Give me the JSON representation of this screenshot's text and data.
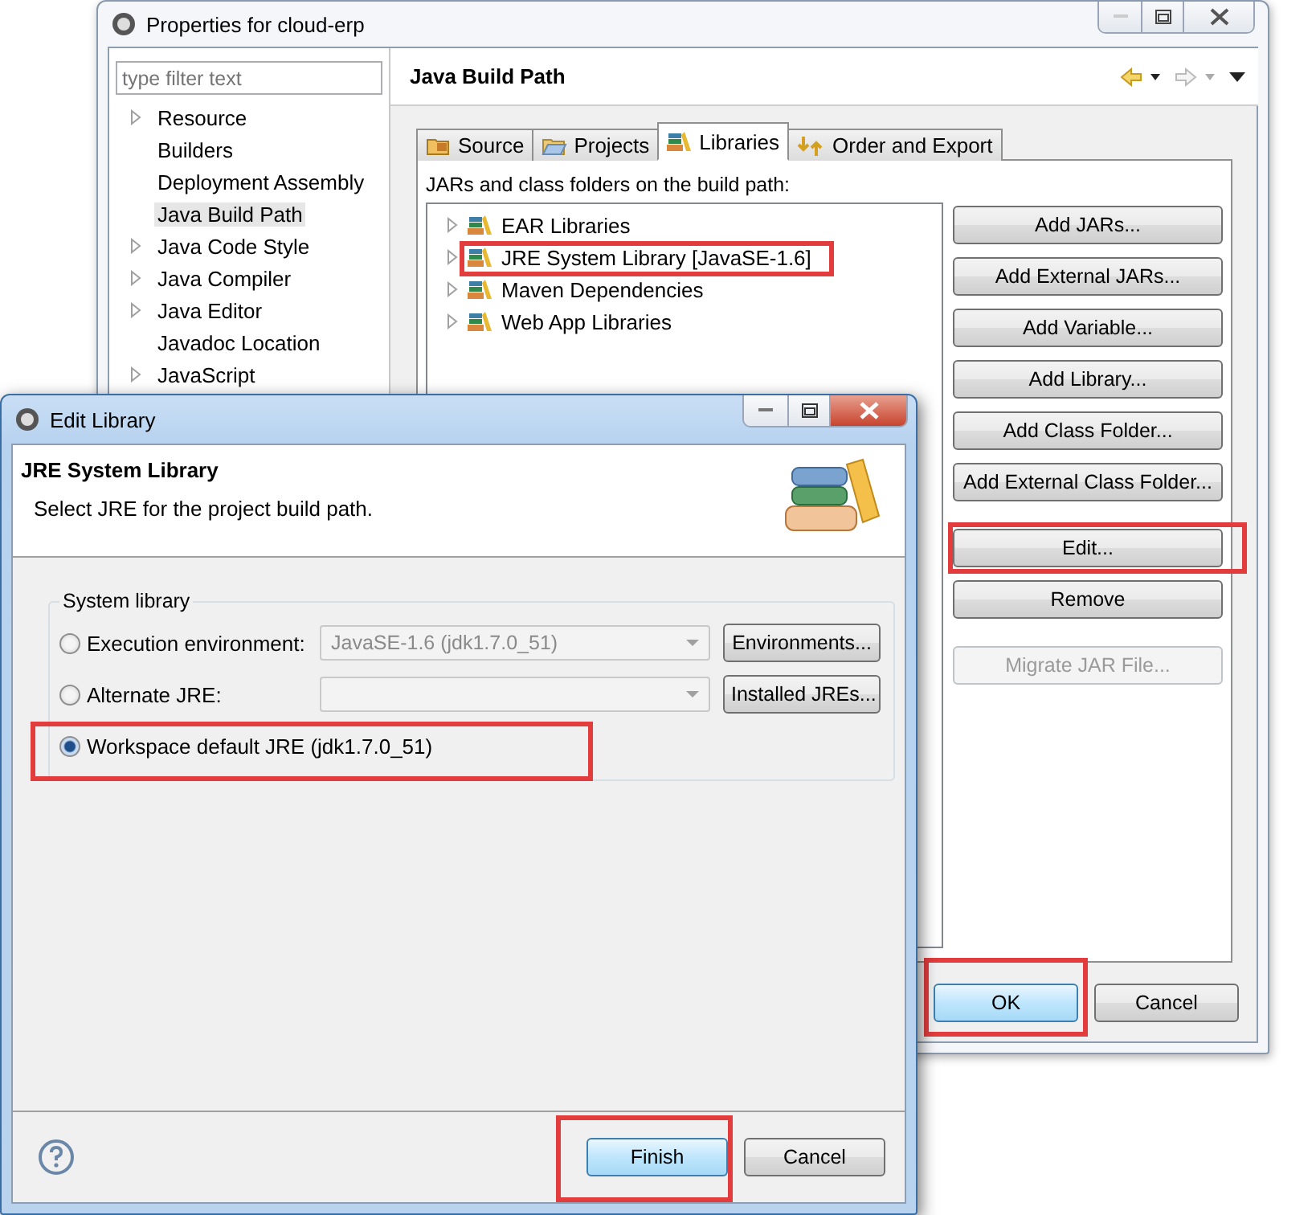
{
  "properties_window": {
    "title": "Properties for cloud-erp",
    "filter": {
      "placeholder": "type filter text"
    },
    "sidebar": {
      "items": [
        {
          "label": "Resource",
          "expandable": true,
          "selected": false
        },
        {
          "label": "Builders",
          "expandable": false,
          "selected": false
        },
        {
          "label": "Deployment Assembly",
          "expandable": false,
          "selected": false
        },
        {
          "label": "Java Build Path",
          "expandable": false,
          "selected": true
        },
        {
          "label": "Java Code Style",
          "expandable": true,
          "selected": false
        },
        {
          "label": "Java Compiler",
          "expandable": true,
          "selected": false
        },
        {
          "label": "Java Editor",
          "expandable": true,
          "selected": false
        },
        {
          "label": "Javadoc Location",
          "expandable": false,
          "selected": false
        },
        {
          "label": "JavaScript",
          "expandable": true,
          "selected": false
        }
      ]
    },
    "page_title": "Java Build Path",
    "tabs": [
      {
        "label": "Source",
        "selected": false
      },
      {
        "label": "Projects",
        "selected": false
      },
      {
        "label": "Libraries",
        "selected": true
      },
      {
        "label": "Order and Export",
        "selected": false
      }
    ],
    "libraries": {
      "caption": "JARs and class folders on the build path:",
      "items": [
        {
          "label": "EAR Libraries",
          "highlighted": false
        },
        {
          "label": "JRE System Library [JavaSE-1.6]",
          "highlighted": true
        },
        {
          "label": "Maven Dependencies",
          "highlighted": false
        },
        {
          "label": "Web App Libraries",
          "highlighted": false
        }
      ]
    },
    "buttons": [
      {
        "label": "Add JARs...",
        "disabled": false,
        "highlighted": false
      },
      {
        "label": "Add External JARs...",
        "disabled": false,
        "highlighted": false
      },
      {
        "label": "Add Variable...",
        "disabled": false,
        "highlighted": false
      },
      {
        "label": "Add Library...",
        "disabled": false,
        "highlighted": false
      },
      {
        "label": "Add Class Folder...",
        "disabled": false,
        "highlighted": false
      },
      {
        "label": "Add External Class Folder...",
        "disabled": false,
        "highlighted": false
      },
      {
        "label": "Edit...",
        "disabled": false,
        "highlighted": true
      },
      {
        "label": "Remove",
        "disabled": false,
        "highlighted": false
      },
      {
        "label": "Migrate JAR File...",
        "disabled": true,
        "highlighted": false
      }
    ],
    "footer_buttons": [
      {
        "label": "OK",
        "default": true,
        "highlighted": true
      },
      {
        "label": "Cancel",
        "default": false,
        "highlighted": false
      }
    ]
  },
  "edit_library_window": {
    "title": "Edit Library",
    "heading": "JRE System Library",
    "description": "Select JRE for the project build path.",
    "group": {
      "label": "System library",
      "options": [
        {
          "kind": "combo",
          "label": "Execution environment:",
          "selected": false,
          "highlighted": false,
          "value": "JavaSE-1.6 (jdk1.7.0_51)",
          "button": "Environments..."
        },
        {
          "kind": "combo",
          "label": "Alternate JRE:",
          "selected": false,
          "highlighted": false,
          "button": "Installed JREs..."
        },
        {
          "kind": "plain",
          "label": "Workspace default JRE (jdk1.7.0_51)",
          "selected": true,
          "highlighted": true
        }
      ]
    },
    "footer_buttons": [
      {
        "label": "Finish",
        "default": true,
        "highlighted": true
      },
      {
        "label": "Cancel",
        "default": false,
        "highlighted": false
      }
    ]
  }
}
